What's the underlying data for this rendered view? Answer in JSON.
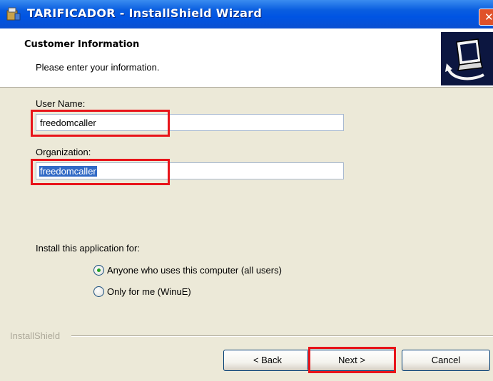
{
  "window": {
    "title": "TARIFICADOR - InstallShield Wizard",
    "close_glyph": "✕"
  },
  "header": {
    "title": "Customer Information",
    "subtitle": "Please enter your information."
  },
  "form": {
    "username_label": "User Name:",
    "username_value": "freedomcaller",
    "organization_label": "Organization:",
    "organization_value": "freedomcaller",
    "install_for_label": "Install this application for:",
    "options": [
      {
        "label": "Anyone who uses this computer (all users)",
        "selected": true
      },
      {
        "label": "Only for me (WinuE)",
        "selected": false
      }
    ]
  },
  "footer": {
    "brand": "InstallShield",
    "back_label": "< Back",
    "next_label": "Next >",
    "cancel_label": "Cancel"
  },
  "colors": {
    "highlight": "#e8141a",
    "titlebar": "#0054e3",
    "selection": "#316ac5",
    "radio_dot": "#21a121"
  },
  "icons": [
    "installer-app-icon",
    "close-icon",
    "computer-install-icon"
  ]
}
